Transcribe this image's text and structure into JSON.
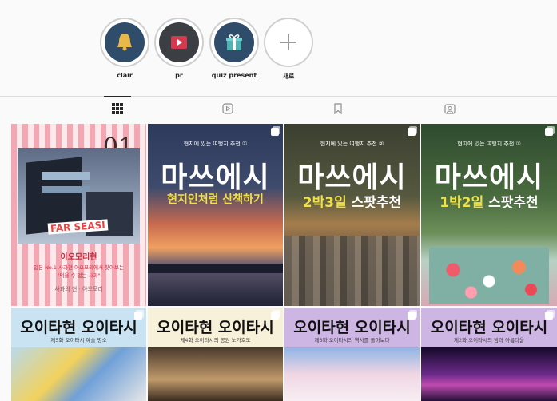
{
  "highlights": [
    {
      "label": "clair",
      "icon": "bell-icon",
      "bg": "#2f4c6a"
    },
    {
      "label": "pr",
      "icon": "video-play-icon",
      "bg": "#3b3f44"
    },
    {
      "label": "quiz present",
      "icon": "gift-icon",
      "bg": "#2f4c6a"
    },
    {
      "label": "새로",
      "icon": "plus-icon",
      "bg": "#ffffff"
    }
  ],
  "tabs": [
    {
      "name": "grid-icon",
      "active": true
    },
    {
      "name": "reels-icon",
      "active": false
    },
    {
      "name": "bookmark-icon",
      "active": false
    },
    {
      "name": "tagged-icon",
      "active": false
    }
  ],
  "posts": {
    "p1": {
      "number": "01",
      "sign": "FAR SEASI",
      "title": "이오모리현",
      "desc_line1": "일본 No.1 사과현 아오모리에서 찾아보는",
      "desc_line2": "\"먹을 수 없는 사과\"",
      "footer": "사과의 현 · 아오모리"
    },
    "p2": {
      "note": "현지에 있는 여행지 추천 ①",
      "title": "마쓰에시",
      "subtitle": "현지인처럼 산책하기",
      "subtitle_color": "#f1e04a"
    },
    "p3": {
      "note": "현지에 있는 여행지 추천 ②",
      "title": "마쓰에시",
      "subtitle_a": "2박3일",
      "subtitle_b": "스팟추천",
      "subtitle_color": "#f1e04a"
    },
    "p4": {
      "note": "현지에 있는 여행지 추천 ③",
      "title": "마쓰에시",
      "subtitle_a": "1박2일",
      "subtitle_b": "스팟추천",
      "subtitle_color": "#f1e04a"
    },
    "row2": [
      {
        "title": "오이타현 오이타시",
        "sub": "제5화 오이타시 예술 명소",
        "bg": "#c9e3f2"
      },
      {
        "title": "오이타현 오이타시",
        "sub": "제4화 오이타시의 공원 노가호도",
        "bg": "#f7f1d9"
      },
      {
        "title": "오이타현 오이타시",
        "sub": "제3화 오이타시의 역사를 돌아보다",
        "bg": "#cdb6e4"
      },
      {
        "title": "오이타현 오이타시",
        "sub": "제2화 오이타시의 밤과 아름다움",
        "bg": "#cdb6e4"
      }
    ]
  },
  "colors": {
    "accent": "#262626",
    "border": "#dbdbdb"
  }
}
